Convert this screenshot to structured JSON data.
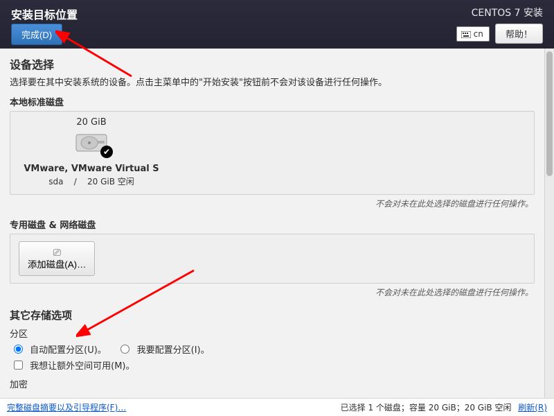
{
  "topbar": {
    "title": "安装目标位置",
    "install_label": "CENTOS 7 安装",
    "lang_code": "cn",
    "help_label": "帮助！",
    "done_label": "完成(D)"
  },
  "device_select": {
    "heading": "设备选择",
    "instruction": "选择要在其中安装系统的设备。点击主菜单中的\"开始安装\"按钮前不会对该设备进行任何操作。"
  },
  "local_disks": {
    "heading": "本地标准磁盘",
    "hint": "不会对未在此处选择的磁盘进行任何操作。",
    "items": [
      {
        "capacity": "20 GiB",
        "name": "VMware, VMware Virtual S",
        "dev": "sda",
        "sep": "/",
        "free": "20 GiB 空闲",
        "selected": true
      }
    ]
  },
  "special_disks": {
    "heading": "专用磁盘 & 网络磁盘",
    "add_label": "添加磁盘(A)…",
    "hint": "不会对未在此处选择的磁盘进行任何操作。"
  },
  "storage_opts": {
    "heading": "其它存储选项",
    "partition_label": "分区",
    "auto_label": "自动配置分区(U)。",
    "manual_label": "我要配置分区(I)。",
    "extra_space_label": "我想让额外空间可用(M)。",
    "encrypt_label": "加密"
  },
  "bottom": {
    "summary_link": "完整磁盘摘要以及引导程序(F)…",
    "status": "已选择 1 个磁盘；容量 20 GiB；20 GiB 空闲",
    "refresh": "刷新(R)"
  }
}
